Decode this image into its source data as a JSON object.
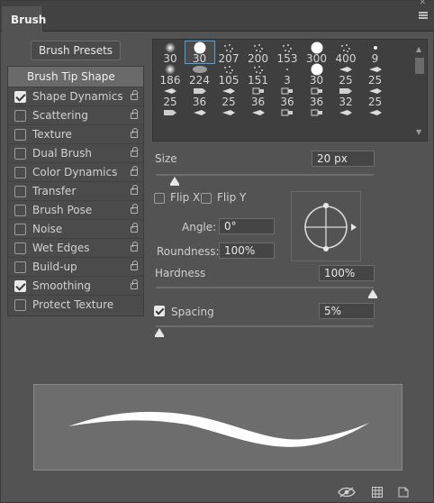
{
  "panel": {
    "tab_label": "Brush",
    "close_glyph": "✕",
    "menu_icon": "panel-menu-icon"
  },
  "presets_button": "Brush Presets",
  "tip_shape_label": "Brush Tip Shape",
  "options": [
    {
      "label": "Shape Dynamics",
      "checked": true
    },
    {
      "label": "Scattering",
      "checked": false
    },
    {
      "label": "Texture",
      "checked": false
    },
    {
      "label": "Dual Brush",
      "checked": false
    },
    {
      "label": "Color Dynamics",
      "checked": false
    },
    {
      "label": "Transfer",
      "checked": false
    },
    {
      "label": "Brush Pose",
      "checked": false
    },
    {
      "label": "Noise",
      "checked": false
    },
    {
      "label": "Wet Edges",
      "checked": false
    },
    {
      "label": "Build-up",
      "checked": false
    },
    {
      "label": "Smoothing",
      "checked": true
    },
    {
      "label": "Protect Texture",
      "checked": false
    }
  ],
  "brush_sizes_row1": [
    "30",
    "30",
    "207",
    "200",
    "153",
    "300",
    "400",
    "9"
  ],
  "brush_sizes_row2": [
    "186",
    "224",
    "105",
    "151",
    "3",
    "30",
    "25",
    "25"
  ],
  "brush_sizes_row3": [
    "25",
    "36",
    "25",
    "36",
    "36",
    "36",
    "32",
    "25"
  ],
  "size": {
    "label": "Size",
    "value": "20 px"
  },
  "flip_x": "Flip X",
  "flip_y": "Flip Y",
  "angle": {
    "label": "Angle:",
    "value": "0°"
  },
  "roundness": {
    "label": "Roundness:",
    "value": "100%"
  },
  "hardness": {
    "label": "Hardness",
    "value": "100%"
  },
  "spacing": {
    "label": "Spacing",
    "value": "5%",
    "checked": true
  },
  "bottom_icons": [
    "eye-icon",
    "grid-icon",
    "new-preset-icon"
  ],
  "colors": {
    "selection": "#4aa3d9",
    "panel_bg": "#535353",
    "stroke": "#ffffff"
  }
}
